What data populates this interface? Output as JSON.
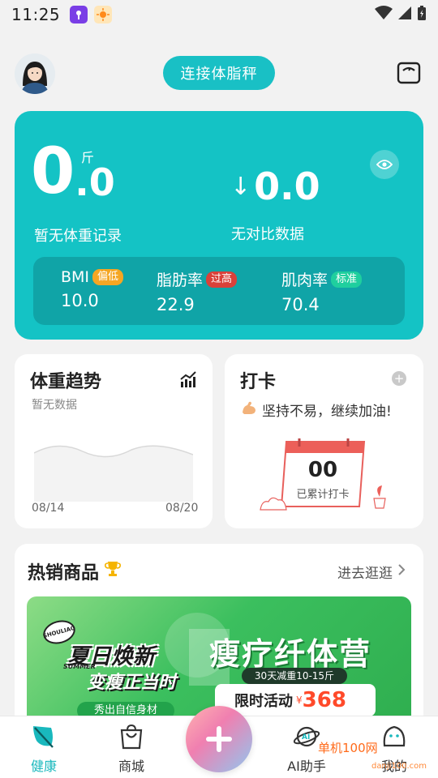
{
  "status_bar": {
    "time": "11:25"
  },
  "header": {
    "connect_label": "连接体脂秤"
  },
  "weight": {
    "value_int": "0",
    "value_dec": ".0",
    "unit": "斤",
    "label": "暂无体重记录",
    "diff_arrow": "↓",
    "diff_value": "0.0",
    "diff_label": "无对比数据"
  },
  "metrics": [
    {
      "name": "BMI",
      "tag": "偏低",
      "tag_color": "#f5a623",
      "value": "10.0"
    },
    {
      "name": "脂肪率",
      "tag": "过高",
      "tag_color": "#d9413a",
      "value": "22.9"
    },
    {
      "name": "肌肉率",
      "tag": "标准",
      "tag_color": "#1fcf9e",
      "value": "70.4"
    }
  ],
  "trend": {
    "title": "体重趋势",
    "subtitle": "暂无数据",
    "date_start": "08/14",
    "date_end": "08/20"
  },
  "checkin": {
    "title": "打卡",
    "message": "坚持不易，继续加油!",
    "count": "00",
    "count_label": "已累计打卡"
  },
  "hot": {
    "title": "热销商品",
    "more": "进去逛逛",
    "banner": {
      "left_title": "夏日焕新",
      "left_sub": "变瘦正当时",
      "summer": "SUMMER",
      "badge": "SHOULIAO",
      "strip": "秀出自信身材",
      "right_title": "瘦疗纤体营",
      "pill": "30天减重10-15斤",
      "promo": "限时活动",
      "currency": "¥",
      "price": "368"
    }
  },
  "tabs": [
    {
      "label": "健康",
      "active": true
    },
    {
      "label": "商城",
      "active": false
    },
    {
      "label": "AI助手",
      "active": false
    },
    {
      "label": "我的",
      "active": false
    }
  ],
  "watermark": {
    "text": "单机100网",
    "url": "danji100.com"
  },
  "colors": {
    "primary": "#19c0c5",
    "card": "#ffffff",
    "background": "#f2f2f2"
  }
}
